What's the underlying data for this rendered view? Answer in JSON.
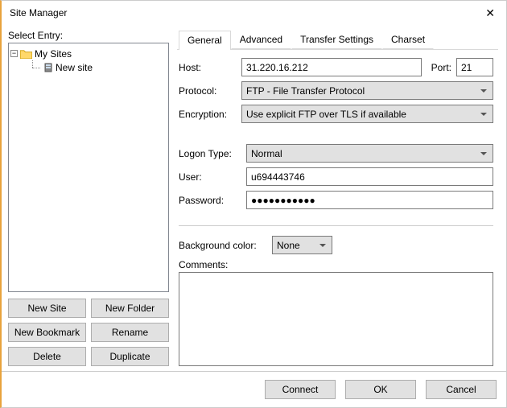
{
  "window": {
    "title": "Site Manager"
  },
  "leftpane": {
    "label": "Select Entry:",
    "root": "My Sites",
    "item": "New site"
  },
  "buttons": {
    "new_site": "New Site",
    "new_folder": "New Folder",
    "new_bookmark": "New Bookmark",
    "rename": "Rename",
    "delete": "Delete",
    "duplicate": "Duplicate"
  },
  "tabs": {
    "general": "General",
    "advanced": "Advanced",
    "transfer": "Transfer Settings",
    "charset": "Charset"
  },
  "form": {
    "host_label": "Host:",
    "host_value": "31.220.16.212",
    "port_label": "Port:",
    "port_value": "21",
    "protocol_label": "Protocol:",
    "protocol_value": "FTP - File Transfer Protocol",
    "encryption_label": "Encryption:",
    "encryption_value": "Use explicit FTP over TLS if available",
    "logon_label": "Logon Type:",
    "logon_value": "Normal",
    "user_label": "User:",
    "user_value": "u694443746",
    "password_label": "Password:",
    "password_value": "●●●●●●●●●●●",
    "bgcolor_label": "Background color:",
    "bgcolor_value": "None",
    "comments_label": "Comments:"
  },
  "footer": {
    "connect": "Connect",
    "ok": "OK",
    "cancel": "Cancel"
  }
}
